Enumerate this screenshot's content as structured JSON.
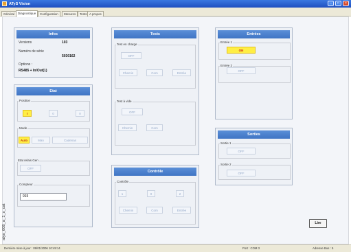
{
  "window": {
    "title": "ATyS Vision"
  },
  "tabs": [
    "Général",
    "Diagnostique",
    "Configuration",
    "Mesures",
    "Tests",
    "A propos"
  ],
  "infos": {
    "title": "Infos",
    "version_label": "Versions",
    "version_value": "103",
    "serial_label": "Numéro de série",
    "serial_value": "5030162",
    "options_label": "Options :",
    "options_value": "RS485 + In/Out(1)"
  },
  "etat": {
    "title": "Etat",
    "position_label": "Position",
    "position_buttons": [
      "I",
      "0",
      "II"
    ],
    "mode_label": "Mode",
    "mode_buttons": [
      "Auto",
      "Man",
      "Cadenas"
    ],
    "relais_label": "Etat relais Gen",
    "relais_value": "OFF",
    "compteur_label": "Compteur",
    "compteur_value": "915"
  },
  "tests": {
    "title": "Tests",
    "en_charge_label": "Test en charge",
    "en_charge_state": "OFF",
    "en_charge_buttons": [
      "Chemin",
      "Com",
      "Entrée"
    ],
    "a_vide_label": "Test à vide",
    "a_vide_state": "OFF",
    "a_vide_buttons": [
      "Chemin",
      "Com"
    ]
  },
  "controle": {
    "title": "Contrôle",
    "group_label": "Contrôle",
    "position_buttons": [
      "1",
      "0",
      "2"
    ],
    "action_buttons": [
      "Chemin",
      "Com",
      "Entrée"
    ]
  },
  "entrees": {
    "title": "Entrées",
    "entree1_label": "Entrée 1",
    "entree1_value": "ON",
    "entree2_label": "Entrée 2",
    "entree2_value": "OFF"
  },
  "sorties": {
    "title": "Sorties",
    "sortie1_label": "Sortie 1",
    "sortie1_value": "OFF",
    "sortie2_label": "Sortie 2",
    "sortie2_value": "OFF"
  },
  "lire_button": "Lire",
  "status": {
    "last_update": "Dernière mise à jour : 09/01/2006 10:49:14",
    "port": "Port : COM 3",
    "bus_address": "Adresse Bus : 5"
  },
  "side_caption": "atys_608_a_1_x_cat",
  "colors": {
    "titlebar": "#2a5fd0",
    "panel_header": "#4a7fcc",
    "active_yellow": "#ffee44",
    "on_red": "#d02010"
  }
}
